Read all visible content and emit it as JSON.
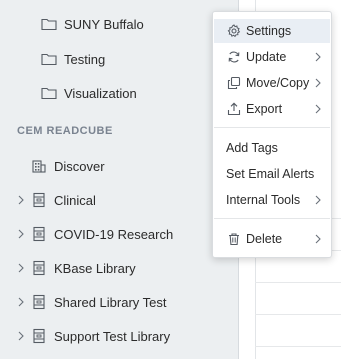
{
  "sidebar": {
    "folders": [
      {
        "label": "SUNY Buffalo"
      },
      {
        "label": "Testing"
      },
      {
        "label": "Visualization"
      }
    ],
    "section_title": "CEM READCUBE",
    "libraries": [
      {
        "label": "Discover"
      },
      {
        "label": "Clinical"
      },
      {
        "label": "COVID-19 Research"
      },
      {
        "label": "KBase Library"
      },
      {
        "label": "Shared Library Test"
      },
      {
        "label": "Support Test Library"
      }
    ]
  },
  "context_menu": {
    "items": [
      {
        "label": "Settings",
        "icon": "gear-icon"
      },
      {
        "label": "Update",
        "icon": "refresh-icon"
      },
      {
        "label": "Move/Copy",
        "icon": "copy-icon"
      },
      {
        "label": "Export",
        "icon": "export-icon"
      },
      {
        "label": "Add Tags"
      },
      {
        "label": "Set Email Alerts"
      },
      {
        "label": "Internal Tools"
      },
      {
        "label": "Delete",
        "icon": "trash-icon"
      }
    ]
  },
  "colors": {
    "sidebar_bg": "#eceff1",
    "menu_hover": "#e9eef4",
    "section_title": "#7a8390",
    "icon": "#555b63"
  }
}
